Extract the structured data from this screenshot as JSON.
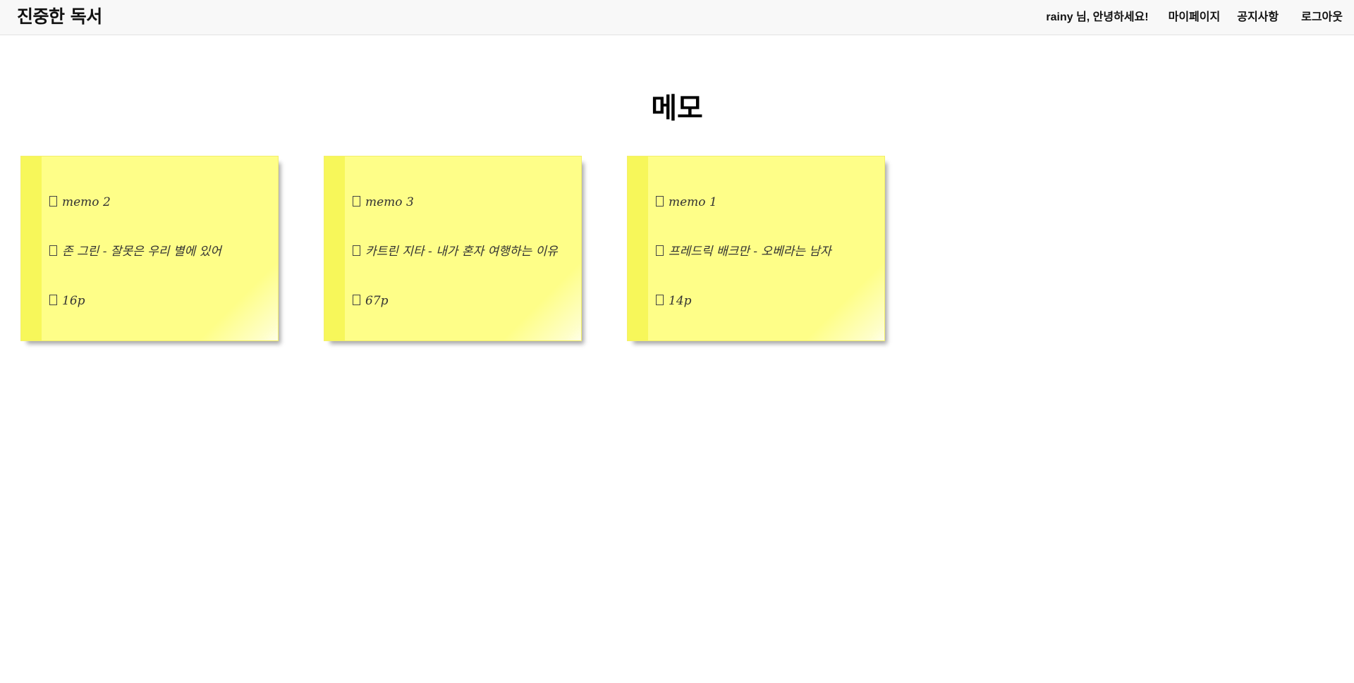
{
  "navbar": {
    "brand": "진중한 독서",
    "greeting": "rainy 님, 안녕하세요!",
    "links": [
      "마이페이지",
      "공지사항",
      "로그아웃"
    ]
  },
  "page": {
    "title": "메모"
  },
  "memos": [
    {
      "title": "memo 2",
      "book": "존 그린 - 잘못은 우리 별에 있어",
      "page": "16p"
    },
    {
      "title": "memo 3",
      "book": "카트린 지타 - 내가 혼자 여행하는 이유",
      "page": "67p"
    },
    {
      "title": "memo 1",
      "book": "프레드릭 배크만 - 오베라는 남자",
      "page": "14p"
    }
  ],
  "colors": {
    "memo_bg": "#fefe88",
    "memo_strip": "#f7f75a",
    "navbar_bg": "#f8f8f8"
  }
}
